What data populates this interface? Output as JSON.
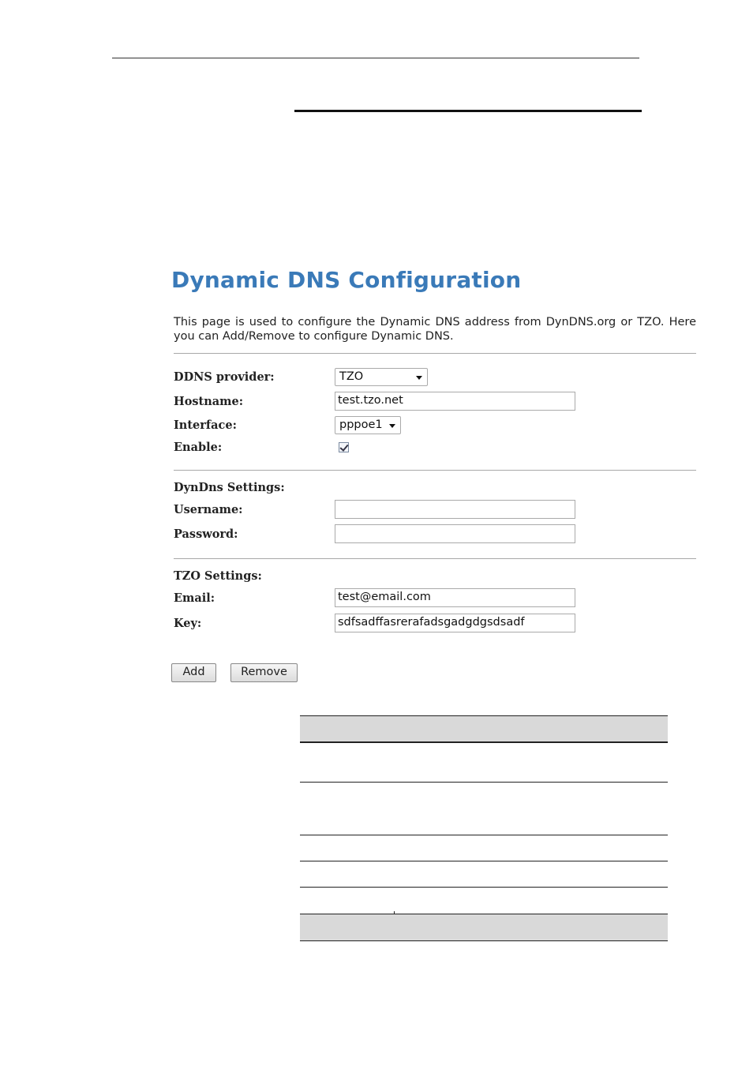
{
  "page": {
    "title": "Dynamic DNS Configuration",
    "description": "This page is used to configure the Dynamic DNS address from DynDNS.org or TZO. Here you can Add/Remove to configure Dynamic DNS."
  },
  "form": {
    "ddns_provider": {
      "label": "DDNS provider:",
      "value": "TZO"
    },
    "hostname": {
      "label": "Hostname:",
      "value": "test.tzo.net"
    },
    "interface": {
      "label": "Interface:",
      "value": "pppoe1"
    },
    "enable": {
      "label": "Enable:",
      "checked": true
    }
  },
  "dyndns": {
    "heading": "DynDns Settings:",
    "username": {
      "label": "Username:",
      "value": ""
    },
    "password": {
      "label": "Password:",
      "value": ""
    }
  },
  "tzo": {
    "heading": "TZO Settings:",
    "email": {
      "label": "Email:",
      "value": "test@email.com"
    },
    "key": {
      "label": "Key:",
      "value": "sdfsadffasrerafadsgadgdgsdsadf"
    }
  },
  "buttons": {
    "add": "Add",
    "remove": "Remove"
  },
  "colors": {
    "title": "#3a7ab8",
    "table_header": "#d9d9d9"
  }
}
